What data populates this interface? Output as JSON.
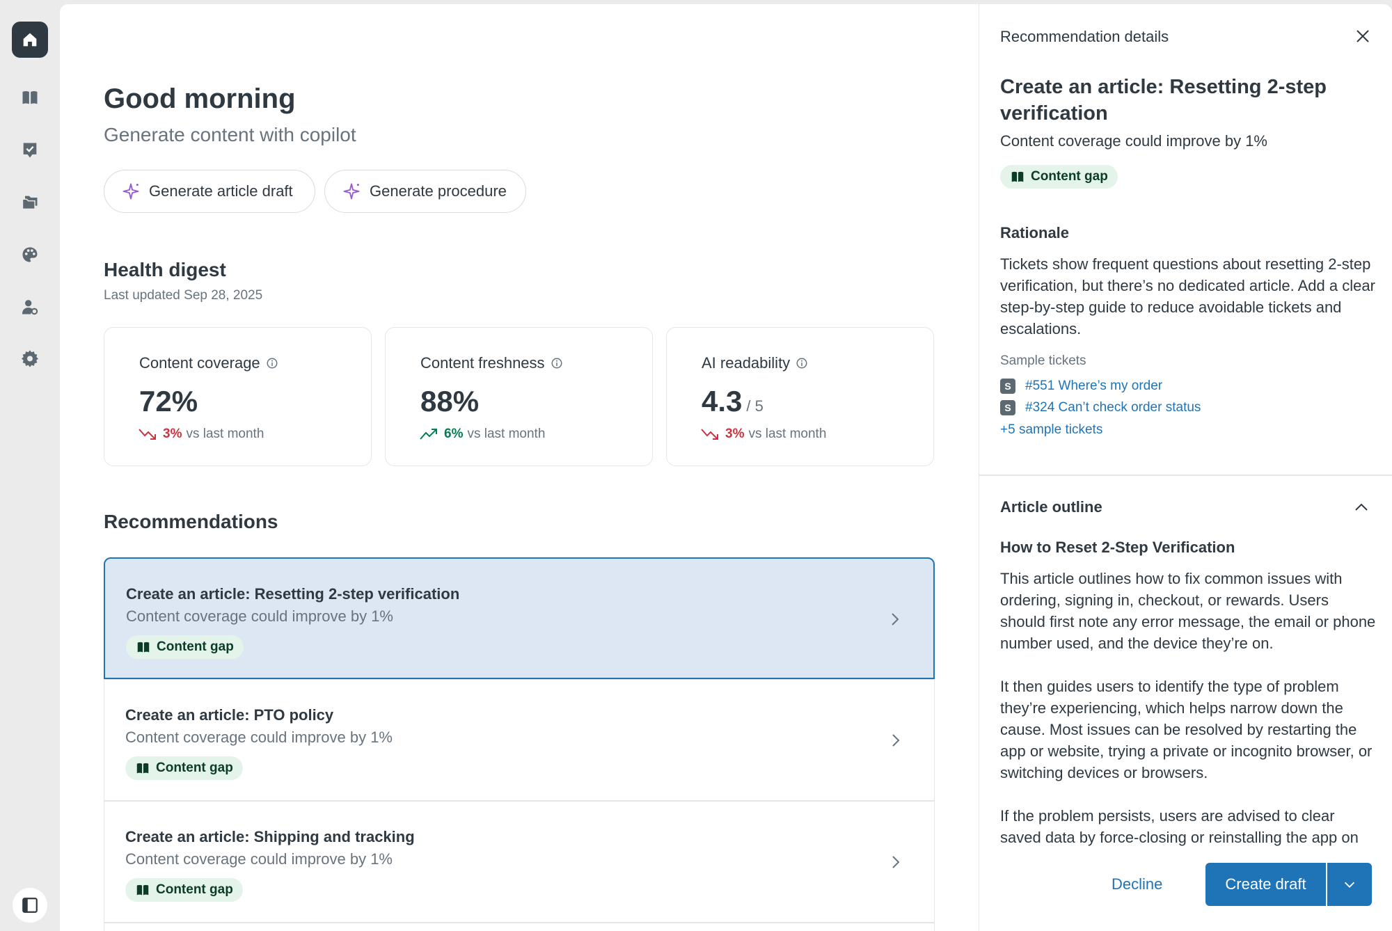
{
  "rail": {
    "items": [
      "home",
      "knowledge",
      "tasks",
      "files",
      "appearance",
      "users",
      "settings"
    ],
    "active": "home"
  },
  "main": {
    "greeting": "Good morning",
    "subtitle": "Generate content with copilot",
    "actions": {
      "article_draft": "Generate article draft",
      "procedure": "Generate procedure"
    },
    "digest": {
      "title": "Health digest",
      "updated": "Last updated Sep 28, 2025",
      "cards": [
        {
          "label": "Content coverage",
          "value": "72%",
          "suffix": "",
          "delta": "3%",
          "direction": "down",
          "compare": "vs last month"
        },
        {
          "label": "Content freshness",
          "value": "88%",
          "suffix": "",
          "delta": "6%",
          "direction": "up",
          "compare": "vs last month"
        },
        {
          "label": "AI readability",
          "value": "4.3",
          "suffix": "/ 5",
          "delta": "3%",
          "direction": "down",
          "compare": "vs last month"
        }
      ]
    },
    "recommendations": {
      "title": "Recommendations",
      "items": [
        {
          "title": "Create an article: Resetting 2-step verification",
          "subtitle": "Content coverage could improve by 1%",
          "badge": "Content gap",
          "selected": true
        },
        {
          "title": "Create an article: PTO policy",
          "subtitle": "Content coverage could improve by 1%",
          "badge": "Content gap",
          "selected": false
        },
        {
          "title": "Create an article: Shipping and tracking",
          "subtitle": "Content coverage could improve by 1%",
          "badge": "Content gap",
          "selected": false
        }
      ]
    }
  },
  "detail": {
    "header": "Recommendation details",
    "title": "Create an article: Resetting 2-step verification",
    "subtitle": "Content coverage could improve by 1%",
    "badge": "Content gap",
    "rationale_heading": "Rationale",
    "rationale": "Tickets show frequent questions about resetting 2-step verification, but there’s no dedicated article. Add a clear step-by-step guide to reduce avoidable tickets and escalations.",
    "sample_heading": "Sample tickets",
    "tickets": [
      {
        "icon": "S",
        "label": "#551 Where’s my order"
      },
      {
        "icon": "S",
        "label": "#324 Can’t check order status"
      }
    ],
    "more_tickets": "+5 sample tickets",
    "outline_heading": "Article outline",
    "outline_title": "How to Reset 2-Step Verification",
    "outline_paragraphs": [
      "This article outlines how to fix common issues with ordering, signing in, checkout, or rewards. Users should first note any error message, the email or phone number used, and the device they’re on.",
      "It then guides users to identify the type of problem they’re experiencing, which helps narrow down the cause. Most issues can be resolved by restarting the app or website, trying a private or incognito browser, or switching devices or browsers.",
      "If the problem persists, users are advised to clear saved data by force-closing or reinstalling the app on"
    ],
    "decline": "Decline",
    "create": "Create draft"
  },
  "colors": {
    "primary": "#1f73b7",
    "selected_bg": "#dce7f3",
    "badge_bg": "#e4f4ea",
    "down": "#cc3340",
    "up": "#037f52",
    "spark": "#9b59d0"
  }
}
